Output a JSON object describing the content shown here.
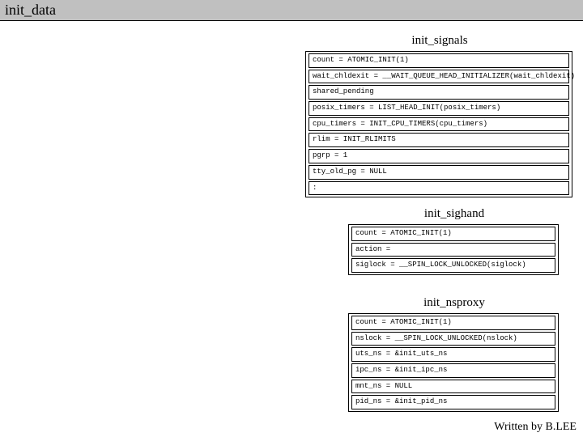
{
  "header": {
    "title": "init_data"
  },
  "footer": {
    "text": "Written by B.LEE"
  },
  "sections": {
    "signals": {
      "title": "init_signals",
      "rows": [
        "count = ATOMIC_INIT(1)",
        "wait_chldexit = __WAIT_QUEUE_HEAD_INITIALIZER(wait_chldexit)",
        "shared_pending",
        "posix_timers = LIST_HEAD_INIT(posix_timers)",
        "cpu_timers = INIT_CPU_TIMERS(cpu_timers)",
        "rlim = INIT_RLIMITS",
        "pgrp = 1",
        "tty_old_pg = NULL",
        ":"
      ]
    },
    "sighand": {
      "title": "init_sighand",
      "rows": [
        "count = ATOMIC_INIT(1)",
        "action =",
        "siglock = __SPIN_LOCK_UNLOCKED(siglock)"
      ]
    },
    "nsproxy": {
      "title": "init_nsproxy",
      "rows": [
        "count = ATOMIC_INIT(1)",
        "nslock = __SPIN_LOCK_UNLOCKED(nslock)",
        "uts_ns = &init_uts_ns",
        "ipc_ns = &init_ipc_ns",
        "mnt_ns = NULL",
        "pid_ns = &init_pid_ns"
      ]
    }
  }
}
